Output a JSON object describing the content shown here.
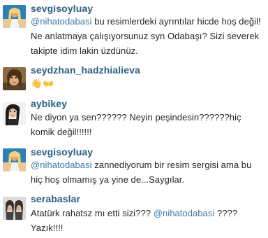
{
  "comments": [
    {
      "username": "sevgisoyluay",
      "avatar": "user-photo-icon",
      "mention": "@nihatodabasi",
      "text": " bu resimlerdeki ayrıntılar hicde hoş değil! Ne anlatmaya çalışıyorsunuz syn Odabaşı? Sizi severek takipte idim lakin üzdünüz."
    },
    {
      "username": "seydzhan_hadzhialieva",
      "avatar": "user-photo-icon",
      "text": "👋👐"
    },
    {
      "username": "aybikey",
      "avatar": "user-photo-icon",
      "text": "Ne diyon ya sen?????? Neyin peşindesin??????hiç komik değil!!!!!!"
    },
    {
      "username": "sevgisoyluay",
      "avatar": "user-photo-icon",
      "mention": "@nihatodabasi",
      "text": " zannediyorum bir resim sergisi ama bu hiç hoş olmamış ya yine de...Saygılar."
    },
    {
      "username": "serabaslar",
      "avatar": "user-photo-icon",
      "text_before": "Atatürk rahatsz mı etti sizi??? ",
      "mention": "@nihatodabasi",
      "text_after": " ???? Yazık!!!!"
    }
  ],
  "colors": {
    "username": "#2b5f80",
    "mention": "#3c7aa6",
    "text": "#262626"
  }
}
